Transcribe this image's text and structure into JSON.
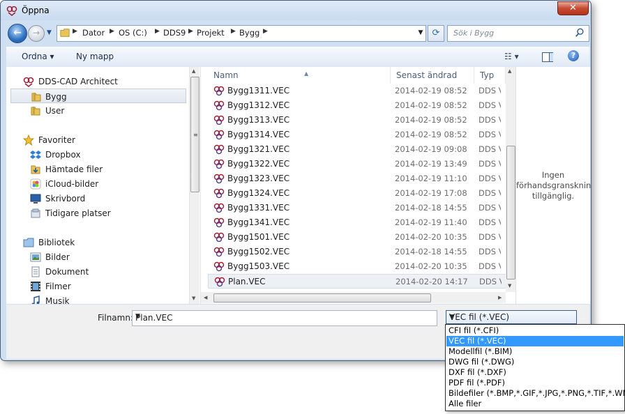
{
  "window": {
    "title": "Öppna"
  },
  "address": {
    "crumbs": [
      "Dator",
      "OS (C:)",
      "DDS9",
      "Projekt",
      "Bygg"
    ]
  },
  "search": {
    "placeholder": "Sök i Bygg"
  },
  "toolbar": {
    "organize_label": "Ordna ▾",
    "new_folder_label": "Ny mapp",
    "view_label": "☷ ▾",
    "help_label": "?"
  },
  "nav": {
    "items": [
      {
        "label": "DDS-CAD Architect",
        "icon": "dds-app-icon"
      },
      {
        "label": "Bygg",
        "icon": "folder-icon",
        "selected": true
      },
      {
        "label": "User",
        "icon": "folder-icon"
      },
      {
        "label": "Favoriter",
        "icon": "star-icon"
      },
      {
        "label": "Dropbox",
        "icon": "dropbox-icon"
      },
      {
        "label": "Hämtade filer",
        "icon": "downloads-icon"
      },
      {
        "label": "iCloud-bilder",
        "icon": "icloud-icon"
      },
      {
        "label": "Skrivbord",
        "icon": "desktop-icon"
      },
      {
        "label": "Tidigare platser",
        "icon": "recent-places-icon"
      },
      {
        "label": "Bibliotek",
        "icon": "library-icon"
      },
      {
        "label": "Bilder",
        "icon": "pictures-icon"
      },
      {
        "label": "Dokument",
        "icon": "documents-icon"
      },
      {
        "label": "Filmer",
        "icon": "videos-icon"
      },
      {
        "label": "Musik",
        "icon": "music-icon"
      }
    ]
  },
  "files": {
    "columns": [
      "Namn",
      "Senast ändrad",
      "Typ"
    ],
    "rows": [
      {
        "name": "Bygg1311.VEC",
        "date": "2014-02-19 08:52",
        "type": "DDS Ve"
      },
      {
        "name": "Bygg1312.VEC",
        "date": "2014-02-19 08:52",
        "type": "DDS Ve"
      },
      {
        "name": "Bygg1313.VEC",
        "date": "2014-02-19 08:52",
        "type": "DDS Ve"
      },
      {
        "name": "Bygg1314.VEC",
        "date": "2014-02-19 08:52",
        "type": "DDS Ve"
      },
      {
        "name": "Bygg1321.VEC",
        "date": "2014-02-19 09:08",
        "type": "DDS Ve"
      },
      {
        "name": "Bygg1322.VEC",
        "date": "2014-02-19 13:49",
        "type": "DDS Ve"
      },
      {
        "name": "Bygg1323.VEC",
        "date": "2014-02-19 11:10",
        "type": "DDS Ve"
      },
      {
        "name": "Bygg1324.VEC",
        "date": "2014-02-19 17:08",
        "type": "DDS Ve"
      },
      {
        "name": "Bygg1331.VEC",
        "date": "2014-02-18 14:55",
        "type": "DDS Ve"
      },
      {
        "name": "Bygg1341.VEC",
        "date": "2014-02-19 11:40",
        "type": "DDS Ve"
      },
      {
        "name": "Bygg1501.VEC",
        "date": "2014-02-20 10:35",
        "type": "DDS Ve"
      },
      {
        "name": "Bygg1502.VEC",
        "date": "2014-02-18 14:55",
        "type": "DDS Ve"
      },
      {
        "name": "Bygg1503.VEC",
        "date": "2014-02-20 10:35",
        "type": "DDS Ve"
      },
      {
        "name": "Plan.VEC",
        "date": "2014-02-20 14:17",
        "type": "DDS Ve",
        "selected": true
      }
    ]
  },
  "preview": {
    "line1": "Ingen",
    "line2": "förhandsgranskning",
    "line3": "tillgänglig."
  },
  "filename": {
    "label": "Filnamn:",
    "value": "Plan.VEC"
  },
  "filetype": {
    "selected": "VEC fil (*.VEC)",
    "options": [
      "CFI fil (*.CFI)",
      "VEC fil (*.VEC)",
      "Modellfil (*.BIM)",
      "DWG fil (*.DWG)",
      "DXF fil (*.DXF)",
      "PDF fil (*.PDF)",
      "Bildefiler (*.BMP,*.GIF,*.JPG,*.PNG,*.TIF,*.WMF)",
      "Alle filer"
    ],
    "highlighted_index": 1
  },
  "colors": {
    "selection": "#3399ff",
    "frame": "#cfe0f2",
    "close": "#c74b32"
  }
}
